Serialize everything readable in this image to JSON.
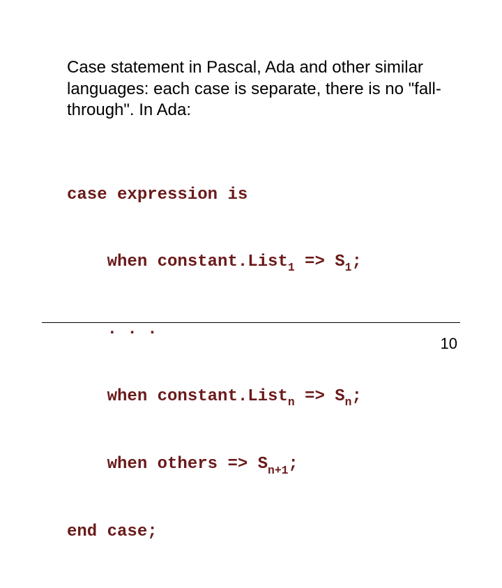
{
  "paragraph": "Case statement in Pascal, Ada and other similar languages: each case is separate, there is no \"fall-through\".  In Ada:",
  "code": {
    "l1": "case expression is",
    "l2_a": "    when constant.List",
    "l2_sub": "1",
    "l2_b": " => S",
    "l2_sub2": "1",
    "l2_c": ";",
    "l3": "    . . .",
    "l4_a": "    when constant.List",
    "l4_sub": "n",
    "l4_b": " => S",
    "l4_sub2": "n",
    "l4_c": ";",
    "l5_a": "    when others => S",
    "l5_sub": "n+1",
    "l5_b": ";",
    "l6": "end case;"
  },
  "page_number": "10"
}
